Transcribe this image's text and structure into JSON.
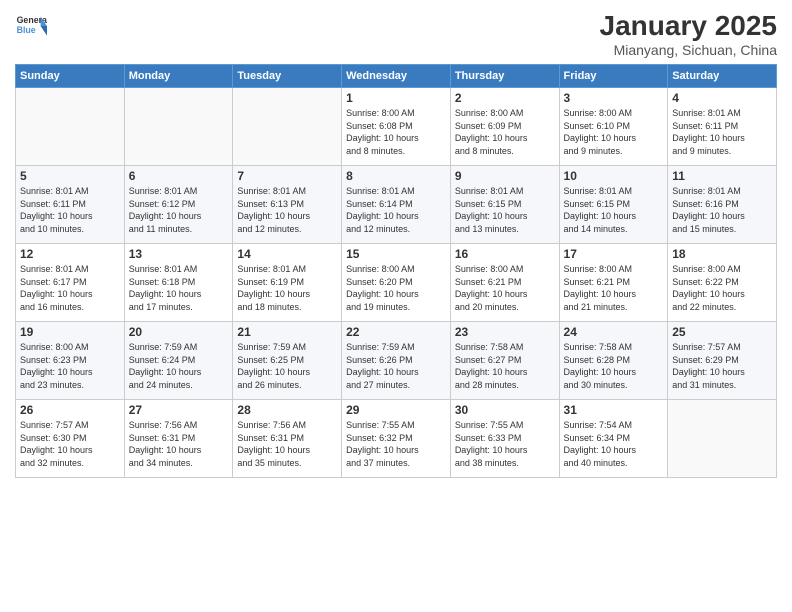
{
  "logo": {
    "line1": "General",
    "line2": "Blue"
  },
  "title": "January 2025",
  "location": "Mianyang, Sichuan, China",
  "days_of_week": [
    "Sunday",
    "Monday",
    "Tuesday",
    "Wednesday",
    "Thursday",
    "Friday",
    "Saturday"
  ],
  "weeks": [
    [
      {
        "day": "",
        "info": ""
      },
      {
        "day": "",
        "info": ""
      },
      {
        "day": "",
        "info": ""
      },
      {
        "day": "1",
        "info": "Sunrise: 8:00 AM\nSunset: 6:08 PM\nDaylight: 10 hours\nand 8 minutes."
      },
      {
        "day": "2",
        "info": "Sunrise: 8:00 AM\nSunset: 6:09 PM\nDaylight: 10 hours\nand 8 minutes."
      },
      {
        "day": "3",
        "info": "Sunrise: 8:00 AM\nSunset: 6:10 PM\nDaylight: 10 hours\nand 9 minutes."
      },
      {
        "day": "4",
        "info": "Sunrise: 8:01 AM\nSunset: 6:11 PM\nDaylight: 10 hours\nand 9 minutes."
      }
    ],
    [
      {
        "day": "5",
        "info": "Sunrise: 8:01 AM\nSunset: 6:11 PM\nDaylight: 10 hours\nand 10 minutes."
      },
      {
        "day": "6",
        "info": "Sunrise: 8:01 AM\nSunset: 6:12 PM\nDaylight: 10 hours\nand 11 minutes."
      },
      {
        "day": "7",
        "info": "Sunrise: 8:01 AM\nSunset: 6:13 PM\nDaylight: 10 hours\nand 12 minutes."
      },
      {
        "day": "8",
        "info": "Sunrise: 8:01 AM\nSunset: 6:14 PM\nDaylight: 10 hours\nand 12 minutes."
      },
      {
        "day": "9",
        "info": "Sunrise: 8:01 AM\nSunset: 6:15 PM\nDaylight: 10 hours\nand 13 minutes."
      },
      {
        "day": "10",
        "info": "Sunrise: 8:01 AM\nSunset: 6:15 PM\nDaylight: 10 hours\nand 14 minutes."
      },
      {
        "day": "11",
        "info": "Sunrise: 8:01 AM\nSunset: 6:16 PM\nDaylight: 10 hours\nand 15 minutes."
      }
    ],
    [
      {
        "day": "12",
        "info": "Sunrise: 8:01 AM\nSunset: 6:17 PM\nDaylight: 10 hours\nand 16 minutes."
      },
      {
        "day": "13",
        "info": "Sunrise: 8:01 AM\nSunset: 6:18 PM\nDaylight: 10 hours\nand 17 minutes."
      },
      {
        "day": "14",
        "info": "Sunrise: 8:01 AM\nSunset: 6:19 PM\nDaylight: 10 hours\nand 18 minutes."
      },
      {
        "day": "15",
        "info": "Sunrise: 8:00 AM\nSunset: 6:20 PM\nDaylight: 10 hours\nand 19 minutes."
      },
      {
        "day": "16",
        "info": "Sunrise: 8:00 AM\nSunset: 6:21 PM\nDaylight: 10 hours\nand 20 minutes."
      },
      {
        "day": "17",
        "info": "Sunrise: 8:00 AM\nSunset: 6:21 PM\nDaylight: 10 hours\nand 21 minutes."
      },
      {
        "day": "18",
        "info": "Sunrise: 8:00 AM\nSunset: 6:22 PM\nDaylight: 10 hours\nand 22 minutes."
      }
    ],
    [
      {
        "day": "19",
        "info": "Sunrise: 8:00 AM\nSunset: 6:23 PM\nDaylight: 10 hours\nand 23 minutes."
      },
      {
        "day": "20",
        "info": "Sunrise: 7:59 AM\nSunset: 6:24 PM\nDaylight: 10 hours\nand 24 minutes."
      },
      {
        "day": "21",
        "info": "Sunrise: 7:59 AM\nSunset: 6:25 PM\nDaylight: 10 hours\nand 26 minutes."
      },
      {
        "day": "22",
        "info": "Sunrise: 7:59 AM\nSunset: 6:26 PM\nDaylight: 10 hours\nand 27 minutes."
      },
      {
        "day": "23",
        "info": "Sunrise: 7:58 AM\nSunset: 6:27 PM\nDaylight: 10 hours\nand 28 minutes."
      },
      {
        "day": "24",
        "info": "Sunrise: 7:58 AM\nSunset: 6:28 PM\nDaylight: 10 hours\nand 30 minutes."
      },
      {
        "day": "25",
        "info": "Sunrise: 7:57 AM\nSunset: 6:29 PM\nDaylight: 10 hours\nand 31 minutes."
      }
    ],
    [
      {
        "day": "26",
        "info": "Sunrise: 7:57 AM\nSunset: 6:30 PM\nDaylight: 10 hours\nand 32 minutes."
      },
      {
        "day": "27",
        "info": "Sunrise: 7:56 AM\nSunset: 6:31 PM\nDaylight: 10 hours\nand 34 minutes."
      },
      {
        "day": "28",
        "info": "Sunrise: 7:56 AM\nSunset: 6:31 PM\nDaylight: 10 hours\nand 35 minutes."
      },
      {
        "day": "29",
        "info": "Sunrise: 7:55 AM\nSunset: 6:32 PM\nDaylight: 10 hours\nand 37 minutes."
      },
      {
        "day": "30",
        "info": "Sunrise: 7:55 AM\nSunset: 6:33 PM\nDaylight: 10 hours\nand 38 minutes."
      },
      {
        "day": "31",
        "info": "Sunrise: 7:54 AM\nSunset: 6:34 PM\nDaylight: 10 hours\nand 40 minutes."
      },
      {
        "day": "",
        "info": ""
      }
    ]
  ]
}
